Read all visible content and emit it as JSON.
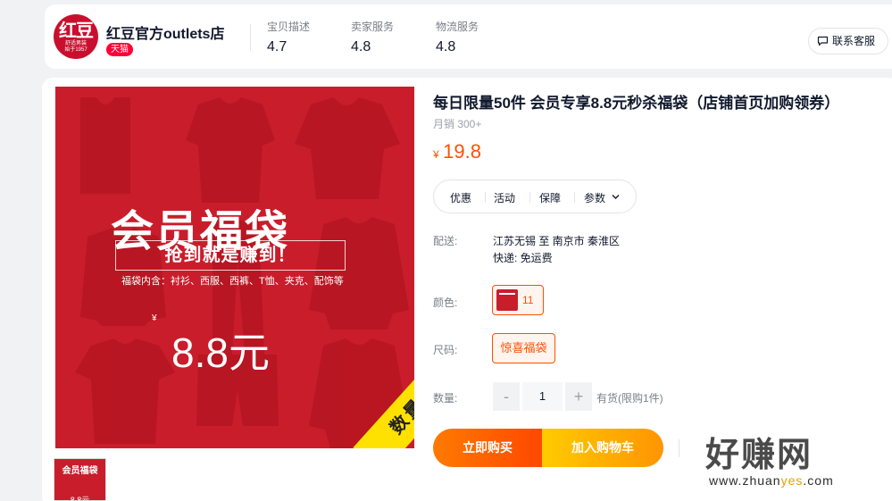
{
  "store": {
    "logo": {
      "line1": "红豆",
      "line2": "舒适男装",
      "line3": "始于1957"
    },
    "name": "红豆官方outlets店",
    "badge": "天猫",
    "scores": [
      {
        "label": "宝贝描述",
        "value": "4.7"
      },
      {
        "label": "卖家服务",
        "value": "4.8"
      },
      {
        "label": "物流服务",
        "value": "4.8"
      }
    ],
    "contact_label": "联系客服"
  },
  "product_image": {
    "headline": "会员福袋",
    "desc": "福袋内含：衬衫、西服、西裤、T恤、夹克、配饰等",
    "slogan": "抢到就是赚到！",
    "yen": "¥",
    "price": "8.8元",
    "ribbon": "数量有限",
    "thumb": {
      "title": "会员福袋",
      "price": "8.8元"
    }
  },
  "product": {
    "title": "每日限量50件 会员专享8.8元秒杀福袋（店铺首页加购领券）",
    "sales": "月销 300+",
    "price_symbol": "¥",
    "price": "19.8",
    "tabs": [
      "优惠",
      "活动",
      "保障",
      "参数"
    ],
    "shipping_label": "配送:",
    "shipping_route": "江苏无锡 至 南京市 秦淮区",
    "shipping_fee": "快递: 免运费",
    "color_label": "颜色:",
    "color_option": "11",
    "size_label": "尺码:",
    "size_option": "惊喜福袋",
    "qty_label": "数量:",
    "qty_minus": "-",
    "qty_value": "1",
    "qty_plus": "+",
    "stock": "有货(限购1件)",
    "buy_now": "立即购买",
    "add_cart": "加入购物车"
  },
  "watermark": {
    "main": "好赚网",
    "url_a": "www.zhuan",
    "url_b": "yes",
    "url_c": ".com"
  },
  "colors": {
    "accent": "#ff5000",
    "brand_red": "#c91d2c",
    "tmall": "#ff0036"
  }
}
